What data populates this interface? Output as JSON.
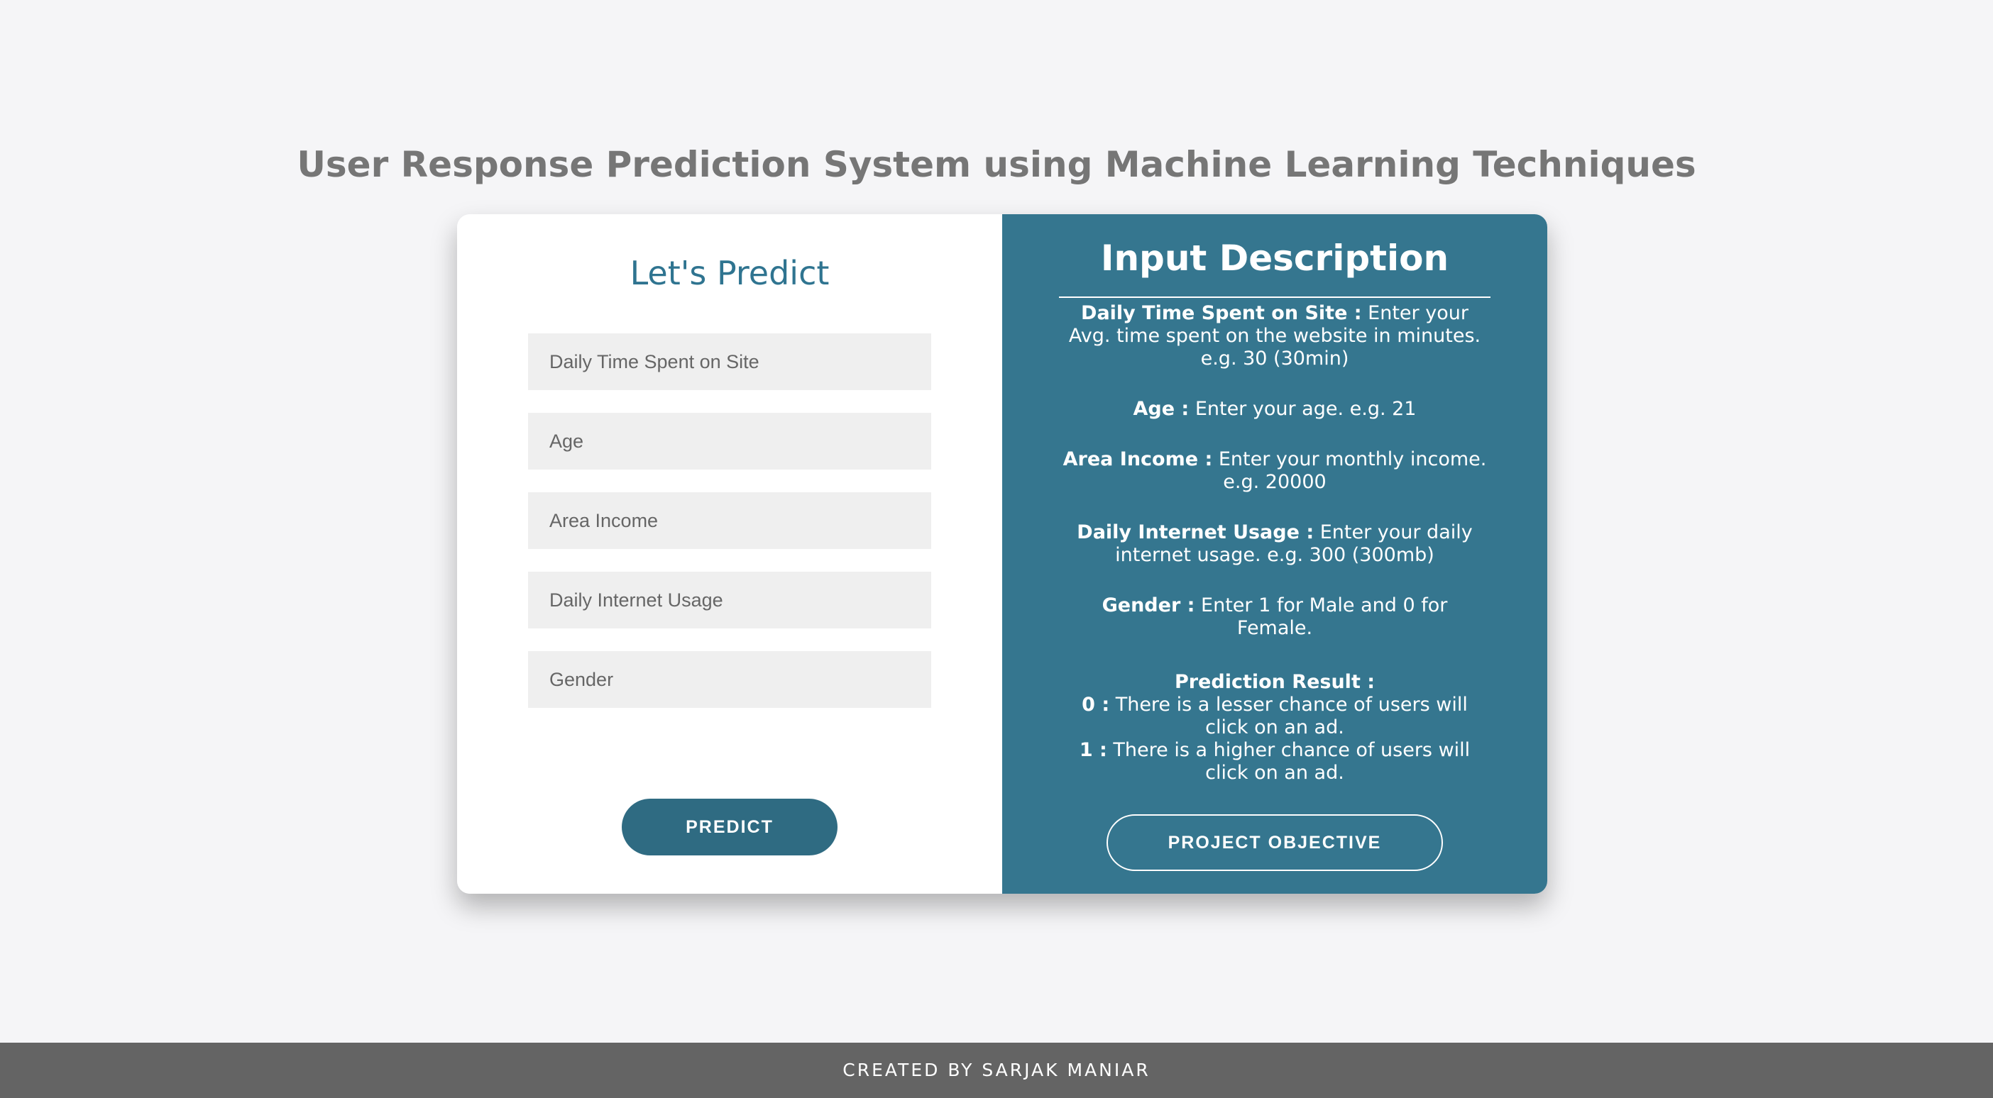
{
  "page": {
    "title": "User Response Prediction System using Machine Learning Techniques"
  },
  "form": {
    "title": "Let's Predict",
    "fields": [
      {
        "placeholder": "Daily Time Spent on Site"
      },
      {
        "placeholder": "Age"
      },
      {
        "placeholder": "Area Income"
      },
      {
        "placeholder": "Daily Internet Usage"
      },
      {
        "placeholder": "Gender"
      }
    ],
    "predict_label": "PREDICT"
  },
  "description": {
    "title": "Input Description",
    "items": [
      {
        "label": "Daily Time Spent on Site :",
        "text": " Enter your Avg. time spent on the website in minutes. e.g. 30 (30min)"
      },
      {
        "label": "Age :",
        "text": " Enter your age. e.g. 21"
      },
      {
        "label": "Area Income :",
        "text": " Enter your monthly income. e.g. 20000"
      },
      {
        "label": "Daily Internet Usage :",
        "text": " Enter your daily internet usage. e.g. 300 (300mb)"
      },
      {
        "label": "Gender :",
        "text": " Enter 1 for Male and 0 for Female."
      }
    ],
    "result": {
      "heading": "Prediction Result :",
      "lines": [
        {
          "label": "0 :",
          "text": " There is a lesser chance of users will click on an ad."
        },
        {
          "label": "1 :",
          "text": " There is a higher chance of users will click on an ad."
        }
      ]
    },
    "objective_label": "PROJECT OBJECTIVE"
  },
  "footer": {
    "text": "CREATED BY SARJAK MANIAR"
  },
  "colors": {
    "accent": "#35768f",
    "button": "#2f6b82",
    "background": "#f5f5f7",
    "footer": "#646464"
  }
}
